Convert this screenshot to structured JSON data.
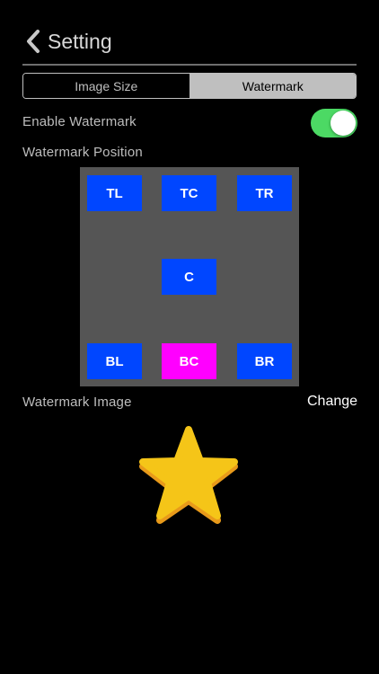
{
  "header": {
    "back_icon": "chevron-left-icon",
    "title": "Setting"
  },
  "segments": [
    {
      "label": "Image Size",
      "selected": false
    },
    {
      "label": "Watermark",
      "selected": true
    }
  ],
  "enable_watermark": {
    "label": "Enable Watermark",
    "on": true,
    "on_color": "#4cd964"
  },
  "position": {
    "label": "Watermark Position",
    "selected": "BC",
    "selected_color": "#ff00ff",
    "button_color": "#0046ff",
    "grid_color": "#555555",
    "buttons": {
      "tl": "TL",
      "tc": "TC",
      "tr": "TR",
      "c": "C",
      "bl": "BL",
      "bc": "BC",
      "br": "BR"
    }
  },
  "watermark_image": {
    "label": "Watermark Image",
    "change_label": "Change",
    "image_icon": "star-icon",
    "star_color": "#f5c518"
  }
}
